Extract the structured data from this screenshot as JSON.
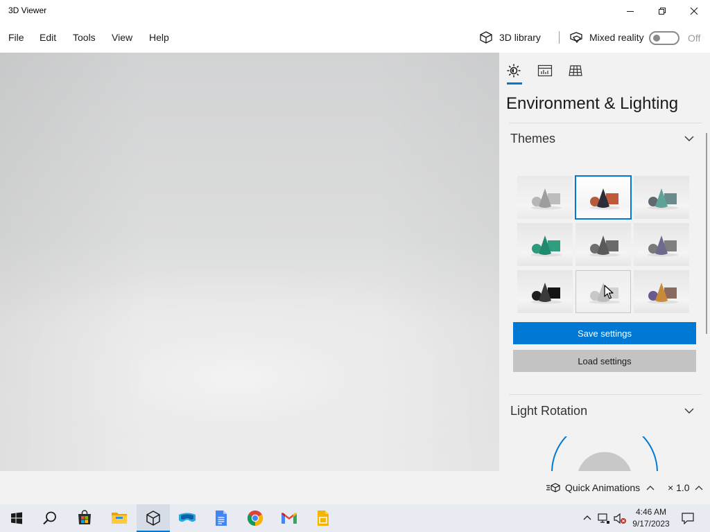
{
  "window": {
    "title": "3D Viewer"
  },
  "menu": {
    "file": "File",
    "edit": "Edit",
    "tools": "Tools",
    "view": "View",
    "help": "Help"
  },
  "toolbar": {
    "library_label": "3D library",
    "mixed_reality_label": "Mixed reality",
    "mixed_reality_state": "Off"
  },
  "panel": {
    "tabs": [
      "lighting-icon",
      "stats-icon",
      "grid-icon"
    ],
    "active_tab": 0,
    "title": "Environment & Lighting",
    "themes_title": "Themes",
    "themes": [
      {
        "bg": "#eaeaea",
        "shapes": [
          "#b7b7b7",
          "#9d9d9d",
          "#bdbdbd"
        ],
        "selected": false
      },
      {
        "bg": "#ffffff",
        "shapes": [
          "#b55a3a",
          "#2d2d3a",
          "#c0583a"
        ],
        "selected": true
      },
      {
        "bg": "#e6e6e6",
        "shapes": [
          "#5d6a6e",
          "#5fa29a",
          "#6b8b8c"
        ],
        "selected": false
      },
      {
        "bg": "#e6e6e6",
        "shapes": [
          "#2e9a7d",
          "#208a6e",
          "#2f9e80"
        ],
        "selected": false
      },
      {
        "bg": "#e6e6e6",
        "shapes": [
          "#6e6e6e",
          "#5a5a5a",
          "#6a6a6a"
        ],
        "selected": false
      },
      {
        "bg": "#e6e6e6",
        "shapes": [
          "#7a7a7a",
          "#6d6a8e",
          "#7f7f7f"
        ],
        "selected": false
      },
      {
        "bg": "#e6e6e6",
        "shapes": [
          "#1e1e1e",
          "#3a3a3a",
          "#141414"
        ],
        "selected": false
      },
      {
        "bg": "#eeeeee",
        "shapes": [
          "#c8c8c8",
          "#bdbdbd",
          "#d2d2d2"
        ],
        "selected": false,
        "hovered": true
      },
      {
        "bg": "#e6e6e6",
        "shapes": [
          "#6a5a8e",
          "#c98a3a",
          "#8a6a5e"
        ],
        "selected": false
      }
    ],
    "save_label": "Save settings",
    "load_label": "Load settings",
    "light_rotation_title": "Light Rotation"
  },
  "statusbar": {
    "quick_animations_label": "Quick Animations",
    "speed_label": "× 1.0"
  },
  "taskbar": {
    "apps": [
      "start-icon",
      "search-icon",
      "store-icon",
      "file-explorer-icon",
      "3d-viewer-icon",
      "mixed-reality-portal-icon",
      "google-docs-icon",
      "chrome-icon",
      "gmail-icon",
      "google-slides-icon"
    ],
    "active_app": "3d-viewer-icon",
    "time": "4:46 AM",
    "date": "9/17/2023"
  },
  "colors": {
    "accent": "#0078d4",
    "panel_bg": "#f2f2f2",
    "secondary_button": "#c3c3c3"
  }
}
